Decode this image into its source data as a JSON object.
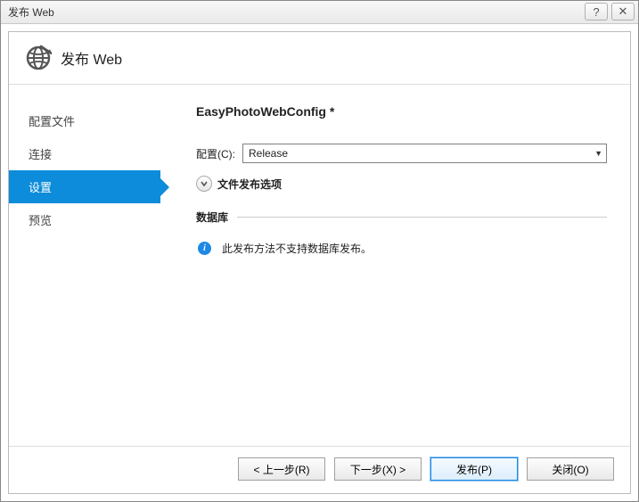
{
  "window": {
    "title": "发布 Web"
  },
  "header": {
    "title": "发布 Web"
  },
  "sidebar": {
    "items": [
      {
        "label": "配置文件",
        "active": false
      },
      {
        "label": "连接",
        "active": false
      },
      {
        "label": "设置",
        "active": true
      },
      {
        "label": "预览",
        "active": false
      }
    ]
  },
  "content": {
    "profile_title": "EasyPhotoWebConfig *",
    "config_label": "配置(C):",
    "config_value": "Release",
    "expander_label": "文件发布选项",
    "db_section_title": "数据库",
    "db_message": "此发布方法不支持数据库发布。"
  },
  "footer": {
    "prev": "< 上一步(R)",
    "next": "下一步(X) >",
    "publish": "发布(P)",
    "close": "关闭(O)"
  },
  "titlebar_icons": {
    "help": "?",
    "close": "✕"
  }
}
